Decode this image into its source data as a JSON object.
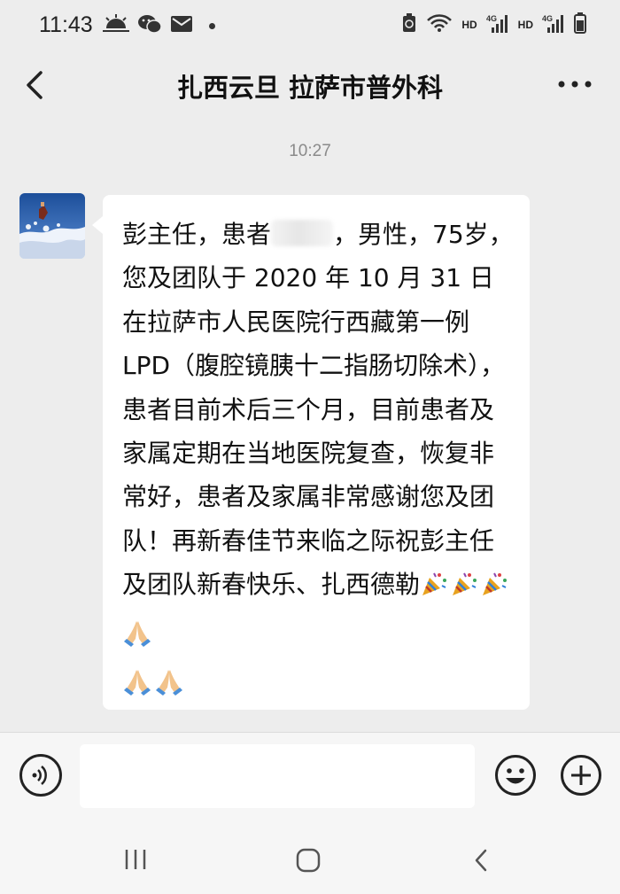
{
  "status_bar": {
    "time": "11:43",
    "network_1": "HD",
    "network_2": "HD",
    "icons": [
      "weather-icon",
      "wechat-icon",
      "mail-icon",
      "notification-dot",
      "recycle-icon",
      "wifi-icon",
      "signal-icon",
      "signal-icon",
      "battery-icon"
    ]
  },
  "header": {
    "title": "扎西云旦 拉萨市普外科",
    "back_icon": "chevron-left-icon",
    "more_icon": "more-dots-icon"
  },
  "chat": {
    "time_label": "10:27",
    "message": {
      "part1": "彭主任，患者",
      "part2": "，男性，75岁，您及团队于 2020 年 10 月 31 日在拉萨市人民医院行西藏第一例 LPD（腹腔镜胰十二指肠切除术），患者目前术后三个月，目前患者及家属定期在当地医院复查，恢复非常好，患者及家属非常感谢您及团队！再新春佳节来临之际祝彭主任及团队新春快乐、扎西德勒",
      "emojis": [
        "party-popper",
        "party-popper",
        "party-popper",
        "folded-hands",
        "folded-hands",
        "folded-hands"
      ]
    }
  },
  "input_bar": {
    "placeholder": "",
    "voice_icon": "voice-icon",
    "emoji_icon": "emoji-icon",
    "plus_icon": "plus-icon"
  },
  "colors": {
    "background": "#ededed",
    "bubble": "#ffffff",
    "text": "#111111",
    "time_label": "#8a8a8a"
  }
}
